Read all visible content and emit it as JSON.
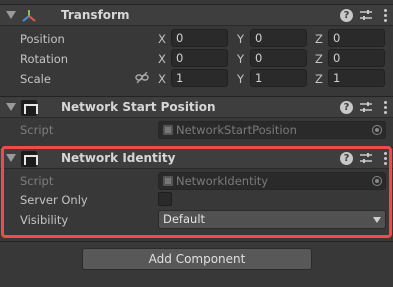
{
  "transform": {
    "title": "Transform",
    "position_label": "Position",
    "rotation_label": "Rotation",
    "scale_label": "Scale",
    "axis_x": "X",
    "axis_y": "Y",
    "axis_z": "Z",
    "position": {
      "x": "0",
      "y": "0",
      "z": "0"
    },
    "rotation": {
      "x": "0",
      "y": "0",
      "z": "0"
    },
    "scale": {
      "x": "1",
      "y": "1",
      "z": "1"
    }
  },
  "nsp": {
    "title": "Network Start Position",
    "script_label": "Script",
    "script_value": "NetworkStartPosition"
  },
  "nid": {
    "title": "Network Identity",
    "script_label": "Script",
    "script_value": "NetworkIdentity",
    "server_only_label": "Server Only",
    "visibility_label": "Visibility",
    "visibility_value": "Default"
  },
  "add_component_label": "Add Component",
  "help_glyph": "?",
  "colors": {
    "highlight": "#f04a4a",
    "panel": "#383838",
    "header": "#3e3e3e"
  }
}
